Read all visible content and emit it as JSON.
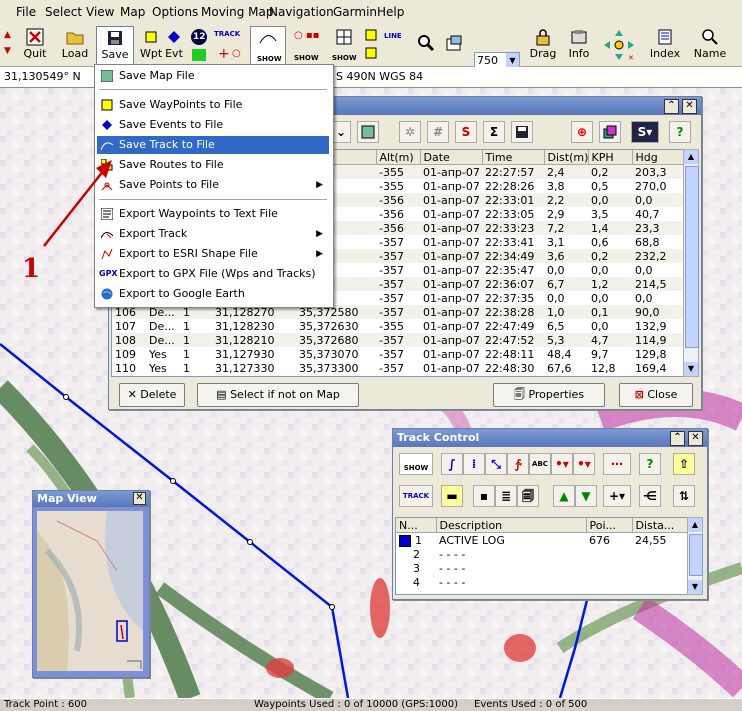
{
  "menu": [
    "File",
    "Select",
    "View",
    "Map",
    "Options",
    "Moving Map",
    "Navigation",
    "Garmin",
    "Help"
  ],
  "toolbar": {
    "quit": "Quit",
    "load": "Load",
    "save": "Save",
    "wpt": "Wpt",
    "evt": "Evt",
    "badge": "12",
    "track_mini": "TRACK",
    "line_mini": "LINE",
    "show_mini": "SHOW",
    "zoom_value": "750",
    "drag": "Drag",
    "info": "Info",
    "index": "Index",
    "name": "Name"
  },
  "coord": {
    "lat": "31,130549° N",
    "datum": "S 490N  WGS 84"
  },
  "dropdown": {
    "items": [
      {
        "label": "Save Map File",
        "icon": "map-icon"
      },
      {
        "label": "Save WayPoints to File",
        "icon": "waypoint-icon"
      },
      {
        "label": "Save Events to File",
        "icon": "event-icon"
      },
      {
        "label": "Save Track to File",
        "icon": "track-icon",
        "highlighted": true
      },
      {
        "label": "Save Routes to File",
        "icon": "route-icon"
      },
      {
        "label": "Save Points to File",
        "icon": "points-icon",
        "submenu": true
      },
      {
        "label": "Export Waypoints to Text File",
        "icon": "text-export-icon"
      },
      {
        "label": "Export Track",
        "icon": "track-export-icon",
        "submenu": true
      },
      {
        "label": "Export to ESRI Shape File",
        "icon": "esri-icon",
        "submenu": true
      },
      {
        "label": "Export to GPX File (Wps and Tracks)",
        "icon": "gpx-icon",
        "prefix": "GPX"
      },
      {
        "label": "Export to Google Earth",
        "icon": "globe-icon"
      }
    ]
  },
  "annotation": "1",
  "points": {
    "columns": [
      "",
      "",
      "",
      "",
      "itude",
      "Alt(m)",
      "Date",
      "Time",
      "Dist(m)",
      "KPH",
      "Hdg"
    ],
    "rows": [
      [
        "",
        "",
        "",
        "",
        "2600",
        "-355",
        "01-апр-07",
        "22:27:57",
        "2,4",
        "0,2",
        "203,3"
      ],
      [
        "",
        "",
        "",
        "",
        "2560",
        "-355",
        "01-апр-07",
        "22:28:26",
        "3,8",
        "0,5",
        "270,0"
      ],
      [
        "",
        "",
        "",
        "",
        "2560",
        "-356",
        "01-апр-07",
        "22:33:01",
        "2,2",
        "0,0",
        "0,0"
      ],
      [
        "",
        "",
        "",
        "",
        "2580",
        "-356",
        "01-апр-07",
        "22:33:05",
        "2,9",
        "3,5",
        "40,7"
      ],
      [
        "",
        "",
        "",
        "",
        "2610",
        "-356",
        "01-апр-07",
        "22:33:23",
        "7,2",
        "1,4",
        "23,3"
      ],
      [
        "",
        "",
        "",
        "",
        "2640",
        "-357",
        "01-апр-07",
        "22:33:41",
        "3,1",
        "0,6",
        "68,8"
      ],
      [
        "",
        "",
        "",
        "",
        "2610",
        "-357",
        "01-апр-07",
        "22:34:49",
        "3,6",
        "0,2",
        "232,2"
      ],
      [
        "",
        "",
        "",
        "",
        "2610",
        "-357",
        "01-апр-07",
        "22:35:47",
        "0,0",
        "0,0",
        "0,0"
      ],
      [
        "",
        "",
        "",
        "",
        "2570",
        "-357",
        "01-апр-07",
        "22:36:07",
        "6,7",
        "1,2",
        "214,5"
      ],
      [
        "",
        "",
        "",
        "",
        "2570",
        "-357",
        "01-апр-07",
        "22:37:35",
        "0,0",
        "0,0",
        "0,0"
      ],
      [
        "106",
        "De...",
        "1",
        "31,128270",
        "35,372580",
        "-357",
        "01-апр-07",
        "22:38:28",
        "1,0",
        "0,1",
        "90,0"
      ],
      [
        "107",
        "De...",
        "1",
        "31,128230",
        "35,372630",
        "-355",
        "01-апр-07",
        "22:47:49",
        "6,5",
        "0,0",
        "132,9"
      ],
      [
        "108",
        "De...",
        "1",
        "31,128210",
        "35,372680",
        "-357",
        "01-апр-07",
        "22:47:52",
        "5,3",
        "4,7",
        "114,9"
      ],
      [
        "109",
        "Yes",
        "1",
        "31,127930",
        "35,373070",
        "-357",
        "01-апр-07",
        "22:48:11",
        "48,4",
        "9,7",
        "129,8"
      ],
      [
        "110",
        "Yes",
        "1",
        "31,127330",
        "35,373300",
        "-357",
        "01-апр-07",
        "22:48:30",
        "67,6",
        "12,8",
        "169,4"
      ]
    ],
    "delete": "Delete",
    "select_if_not": "Select if not on Map",
    "properties": "Properties",
    "close": "Close"
  },
  "track_control": {
    "title": "Track Control",
    "show_mini": "SHOW",
    "track_mini": "TRACK",
    "abc": "ABC",
    "columns": [
      "N...",
      "Description",
      "Poi...",
      "Dista..."
    ],
    "rows": [
      {
        "n": "1",
        "desc": "ACTIVE LOG",
        "points": "676",
        "dist": "24,55",
        "color": "#0000cc"
      },
      {
        "n": "2",
        "desc": "- - - -",
        "points": "",
        "dist": ""
      },
      {
        "n": "3",
        "desc": "- - - -",
        "points": "",
        "dist": ""
      },
      {
        "n": "4",
        "desc": "- - - -",
        "points": "",
        "dist": ""
      }
    ]
  },
  "map_view": {
    "title": "Map View"
  },
  "status": {
    "track_point": "Track Point : 600",
    "waypoints": "Waypoints Used : 0 of 10000  (GPS:1000)",
    "events": "Events Used : 0 of 500"
  }
}
